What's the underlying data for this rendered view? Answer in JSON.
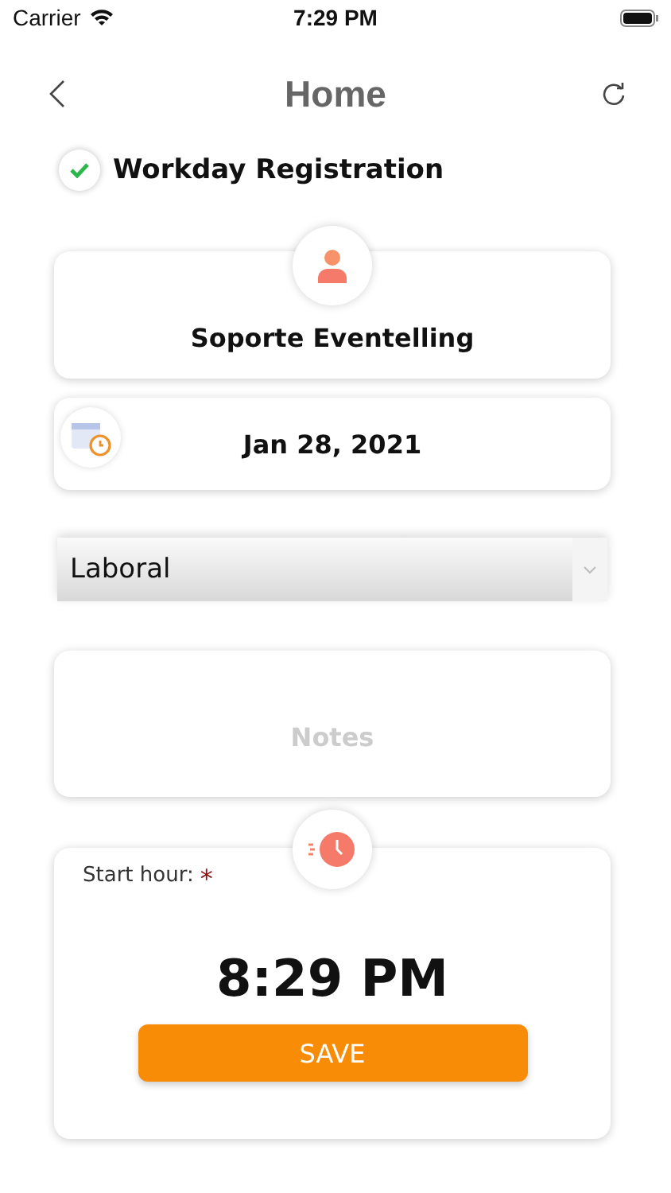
{
  "status_bar": {
    "carrier": "Carrier",
    "time": "7:29 PM"
  },
  "header": {
    "title": "Home"
  },
  "registration": {
    "label": "Workday Registration",
    "checked": true
  },
  "user": {
    "name": "Soporte Eventelling"
  },
  "date": {
    "value": "Jan 28, 2021"
  },
  "type_select": {
    "value": "Laboral"
  },
  "notes": {
    "placeholder": "Notes"
  },
  "start": {
    "label": "Start hour:",
    "marker": "*",
    "time": "8:29 PM"
  },
  "save_button": {
    "label": "SAVE"
  }
}
